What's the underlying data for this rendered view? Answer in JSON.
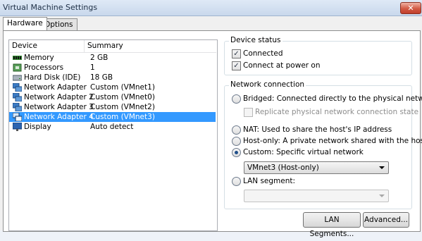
{
  "window": {
    "title": "Virtual Machine Settings",
    "close_label": "✕"
  },
  "tabs": [
    {
      "label": "Hardware"
    },
    {
      "label": "Options"
    }
  ],
  "device_list": {
    "columns": [
      "Device",
      "Summary"
    ],
    "rows": [
      {
        "device": "Memory",
        "summary": "2 GB",
        "icon": "memory-icon"
      },
      {
        "device": "Processors",
        "summary": "1",
        "icon": "processor-icon"
      },
      {
        "device": "Hard Disk (IDE)",
        "summary": "18 GB",
        "icon": "hard-disk-icon"
      },
      {
        "device": "Network Adapter",
        "summary": "Custom (VMnet1)",
        "icon": "network-adapter-icon"
      },
      {
        "device": "Network Adapter 2",
        "summary": "Custom (VMnet0)",
        "icon": "network-adapter-icon"
      },
      {
        "device": "Network Adapter 3",
        "summary": "Custom (VMnet2)",
        "icon": "network-adapter-icon"
      },
      {
        "device": "Network Adapter 4",
        "summary": "Custom (VMnet3)",
        "icon": "network-adapter-icon",
        "selected": true
      },
      {
        "device": "Display",
        "summary": "Auto detect",
        "icon": "display-icon"
      }
    ]
  },
  "device_status": {
    "legend": "Device status",
    "connected": {
      "label": "Connected",
      "checked": true
    },
    "connect_at_power_on": {
      "label": "Connect at power on",
      "checked": true
    }
  },
  "network_connection": {
    "legend": "Network connection",
    "bridged": {
      "label": "Bridged: Connected directly to the physical network",
      "checked": false
    },
    "replicate": {
      "label": "Replicate physical network connection state",
      "checked": false,
      "enabled": false
    },
    "nat": {
      "label": "NAT: Used to share the host's IP address",
      "checked": false
    },
    "host_only": {
      "label": "Host-only: A private network shared with the host",
      "checked": false
    },
    "custom": {
      "label": "Custom: Specific virtual network",
      "checked": true
    },
    "custom_select": {
      "value": "VMnet3 (Host-only)"
    },
    "lan_segment": {
      "label": "LAN segment:",
      "checked": false
    },
    "lan_select": {
      "value": ""
    }
  },
  "buttons": {
    "lan_segments": "LAN Segments...",
    "advanced": "Advanced..."
  }
}
